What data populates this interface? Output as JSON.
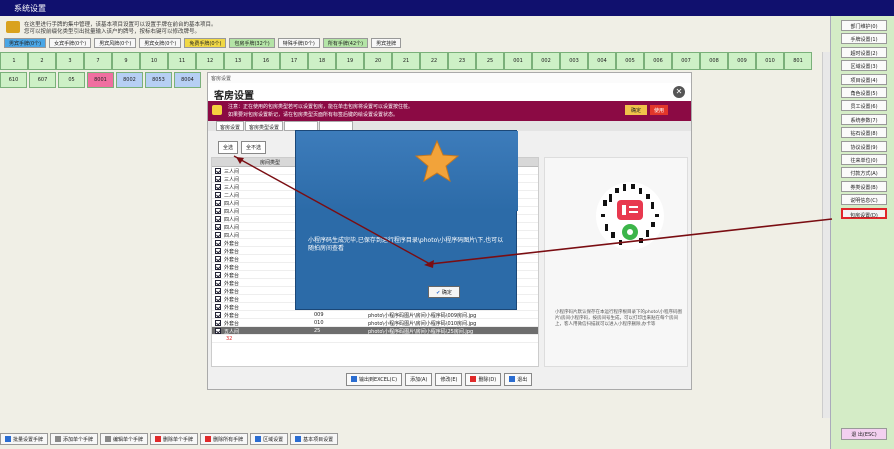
{
  "window": {
    "title": "系统设置"
  },
  "top_note": {
    "line1": "在这里进行手牌的集中管理，该基本项目设置可以设置手牌在前台的基本项目。",
    "line2": "您可以按前缀化类型引出批量输入该户的牌号，按标右键可以修改牌号。"
  },
  "tabs": [
    {
      "label": "男宾手牌(0个)",
      "color": "#4aa6e6"
    },
    {
      "label": "女宾手牌(0个)",
      "color": "#f7f7f7"
    },
    {
      "label": "男宾风牌(0个)",
      "color": "#f7f7f7"
    },
    {
      "label": "男宾女牌(0个)",
      "color": "#f7f7f7"
    },
    {
      "label": "免费手牌(0个)",
      "color": "#f0d845"
    },
    {
      "label": "包房手牌(32个)",
      "color": "#b4e4a6"
    },
    {
      "label": "特殊手牌(0个)",
      "color": "#f7f7f7"
    },
    {
      "label": "所有手牌(42个)",
      "color": "#b4e4a6"
    },
    {
      "label": "男宾挂牌",
      "color": "#f7f7f7"
    }
  ],
  "grid_row1": [
    "1",
    "2",
    "3",
    "7",
    "9",
    "10",
    "11",
    "12",
    "13",
    "16",
    "17",
    "18",
    "19",
    "20",
    "21",
    "22",
    "23",
    "25",
    "001",
    "002",
    "003",
    "004",
    "005",
    "006",
    "007",
    "008",
    "009",
    "010",
    "801"
  ],
  "grid_row2": [
    {
      "label": "610",
      "style": ""
    },
    {
      "label": "607",
      "style": ""
    },
    {
      "label": "05",
      "style": ""
    },
    {
      "label": "8001",
      "style": "pink"
    },
    {
      "label": "8002",
      "style": "blue"
    },
    {
      "label": "8053",
      "style": "blue"
    },
    {
      "label": "8004",
      "style": "blue"
    }
  ],
  "right_buttons": [
    {
      "label": "部门维护(0)"
    },
    {
      "label": "手牌设置(1)"
    },
    {
      "label": "超时设置(2)"
    },
    {
      "label": "区域设置(3)"
    },
    {
      "label": "项目设置(4)"
    },
    {
      "label": "角色设置(5)"
    },
    {
      "label": "员工设置(6)"
    },
    {
      "label": "系统参数(7)"
    },
    {
      "label": "钻石设置(8)"
    },
    {
      "label": "协议设置(9)"
    },
    {
      "label": "往来单位(0)"
    },
    {
      "label": "付款方式(A)"
    },
    {
      "label": "券类设置(B)"
    },
    {
      "label": "说明信息(C)"
    },
    {
      "label": "包房设置(D)",
      "highlight": true
    }
  ],
  "exit_button": "退  出(ESC)",
  "bottom_buttons": [
    {
      "label": "批量设置手牌",
      "color": "#2b6dd1"
    },
    {
      "label": "添加单个手牌",
      "color": "#888888"
    },
    {
      "label": "编辑单个手牌",
      "color": "#888888"
    },
    {
      "label": "删除单个手牌",
      "color": "#e02a2a"
    },
    {
      "label": "删除所有手牌",
      "color": "#e02a2a"
    },
    {
      "label": "区域设置",
      "color": "#2b6dd1"
    },
    {
      "label": "基本项目设置",
      "color": "#2b6dd1"
    }
  ],
  "dialog": {
    "caption": "客房设置",
    "title": "客房设置",
    "notice1": "注意：正在使用的包房类型若可以设置包房，能在单击包房将设置可以设置按住桩。",
    "notice2": "如果要对包房设置新记，请在包房类型页面所有标签后键的绘设置设置状态。",
    "ok_label": "确定",
    "use_label": "使用",
    "subtabs": [
      "客房设置",
      "客房类型设置",
      "",
      ""
    ],
    "select_all": "全选",
    "select_none": "全不选",
    "table_header": "房间类型",
    "rows": [
      {
        "c1": "三人间",
        "c2": "",
        "c3": ""
      },
      {
        "c1": "三人间",
        "c2": "",
        "c3": ""
      },
      {
        "c1": "三人间",
        "c2": "",
        "c3": ""
      },
      {
        "c1": "二人间",
        "c2": "",
        "c3": ""
      },
      {
        "c1": "四人间",
        "c2": "",
        "c3": ""
      },
      {
        "c1": "四人间",
        "c2": "",
        "c3": ""
      },
      {
        "c1": "四人间",
        "c2": "",
        "c3": ""
      },
      {
        "c1": "四人间",
        "c2": "",
        "c3": ""
      },
      {
        "c1": "四人间",
        "c2": "",
        "c3": ""
      },
      {
        "c1": "外套台",
        "c2": "",
        "c3": ""
      },
      {
        "c1": "外套台",
        "c2": "",
        "c3": ""
      },
      {
        "c1": "外套台",
        "c2": "",
        "c3": ""
      },
      {
        "c1": "外套台",
        "c2": "",
        "c3": ""
      },
      {
        "c1": "外套台",
        "c2": "",
        "c3": ""
      },
      {
        "c1": "外套台",
        "c2": "",
        "c3": ""
      },
      {
        "c1": "外套台",
        "c2": "",
        "c3": ""
      },
      {
        "c1": "外套台",
        "c2": "007",
        "c3": "photo\\小程序码图片\\房间小程序码\\007房间.jpg"
      },
      {
        "c1": "外套台",
        "c2": "008",
        "c3": "photo\\小程序码图片\\房间小程序码\\008房间.jpg"
      },
      {
        "c1": "外套台",
        "c2": "009",
        "c3": "photo\\小程序码图片\\房间小程序码\\009房间.jpg"
      },
      {
        "c1": "外套台",
        "c2": "010",
        "c3": "photo\\小程序码图片\\房间小程序码\\010房间.jpg"
      },
      {
        "c1": "五人间",
        "c2": "25",
        "c3": "photo\\小程序码图片\\房间小程序码\\25房间.jpg",
        "selected": true
      }
    ],
    "count_text": "32",
    "qr_text": "小程序码片默认保存在本运行程序根目录下的photo\\小程序码图片\\房间小程序码，按房间号生成，可以打印出来贴在每个房间上，客人用微信扫描就可以进入小程序删除,办卡等",
    "buttons": [
      {
        "label": "输出到EXCEL(C)",
        "color": "#2b6dd1"
      },
      {
        "label": "添加(A)",
        "color": ""
      },
      {
        "label": "修改(E)",
        "color": ""
      },
      {
        "label": "删除(D)",
        "color": "#e02a2a"
      },
      {
        "label": "退出",
        "color": "#2b6dd1"
      }
    ]
  },
  "popup": {
    "message": "小程序码生成完毕,已保存到运行程序目录\\photo\\小程序码图片\\下,也可以随拍房间查看",
    "ok_label": "确定"
  }
}
